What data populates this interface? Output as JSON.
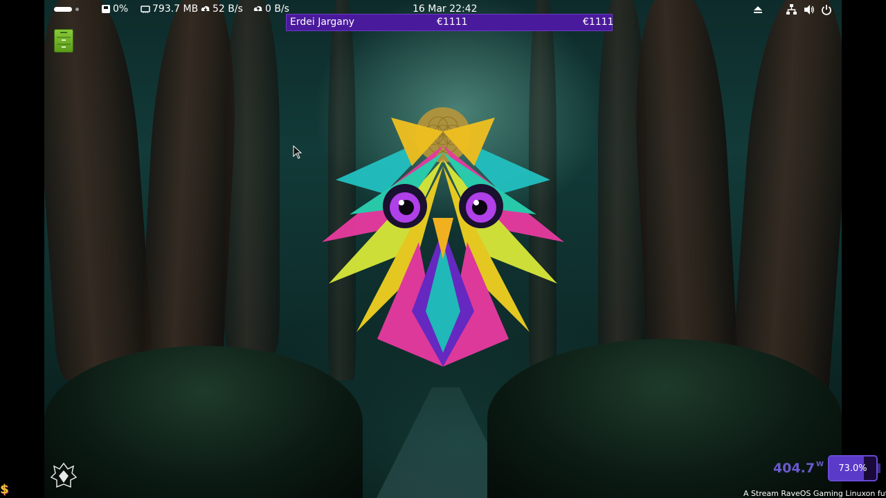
{
  "topbar": {
    "disk_usage": "0%",
    "memory": "793.7 MB",
    "download_speed": "52 B/s",
    "upload_speed": "0 B/s",
    "clock": "16 Mar  22:42",
    "icons": [
      "drive-icon",
      "memory-icon",
      "cloud-download-icon",
      "cloud-upload-icon",
      "eject-icon",
      "network-icon",
      "volume-icon",
      "power-icon"
    ]
  },
  "ticker": {
    "name": "Erdei Jargany",
    "price_1": "€1111",
    "price_2": "€1111"
  },
  "power": {
    "watts": "404.7",
    "unit": "W",
    "battery_percent": "73.0%",
    "battery_level": 0.73
  },
  "stream_text": "A Stream RaveOS Gaming Linuxon fut",
  "colors": {
    "ticker_bg": "#4a1a9c",
    "accent": "#6a5acd",
    "launcher": "#7ab82a"
  }
}
